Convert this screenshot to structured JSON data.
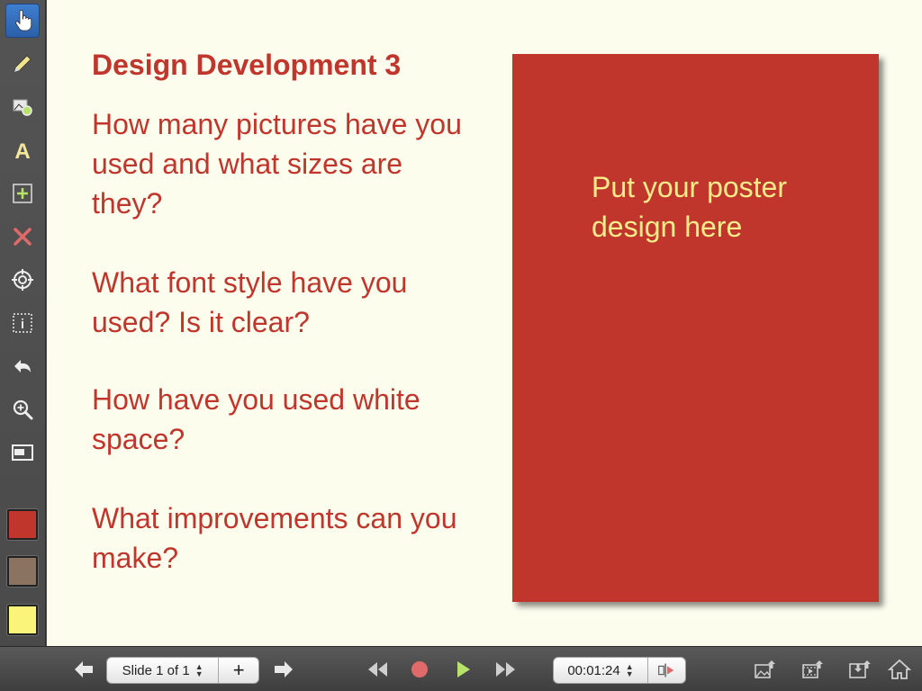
{
  "toolbar": {
    "tools": [
      {
        "name": "hand-pointer",
        "active": true
      },
      {
        "name": "pen"
      },
      {
        "name": "insert-image"
      },
      {
        "name": "text"
      },
      {
        "name": "add-box"
      },
      {
        "name": "delete"
      },
      {
        "name": "target"
      },
      {
        "name": "info-frame"
      },
      {
        "name": "undo"
      },
      {
        "name": "zoom"
      },
      {
        "name": "window"
      }
    ],
    "colors": [
      "#c0362c",
      "#8a7360",
      "#fbf47a"
    ]
  },
  "slide": {
    "title": "Design Development 3",
    "questions": [
      "How many pictures have you used and what sizes are they?",
      "What font style have you used? Is it clear?",
      "How have you used white space?",
      "What improvements can you make?"
    ],
    "poster_text": "Put your poster design here",
    "poster_color": "#c0362c",
    "text_color": "#c0362c",
    "poster_text_color": "#f7ec8a",
    "background": "#fdfdee"
  },
  "bottombar": {
    "slide_label": "Slide 1 of 1",
    "add_label": "+",
    "timer": "00:01:24"
  }
}
